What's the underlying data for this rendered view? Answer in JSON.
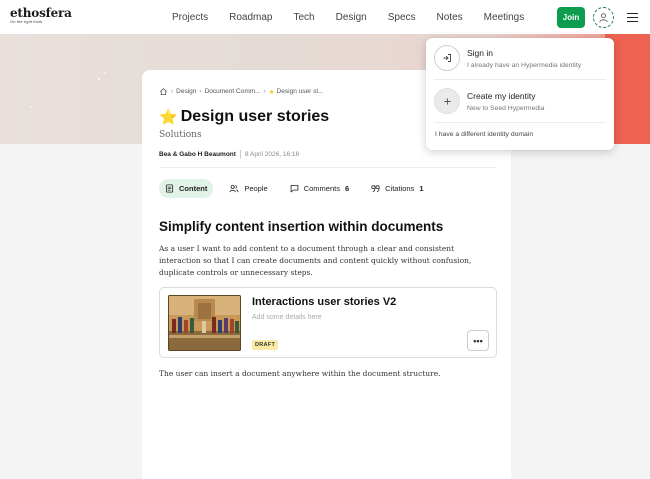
{
  "brand": {
    "name": "ethosfera",
    "tagline": "On the right think"
  },
  "nav": {
    "items": [
      {
        "label": "Projects"
      },
      {
        "label": "Roadmap"
      },
      {
        "label": "Tech"
      },
      {
        "label": "Design"
      },
      {
        "label": "Specs"
      },
      {
        "label": "Notes"
      },
      {
        "label": "Meetings"
      }
    ],
    "join_label": "Join"
  },
  "document": {
    "breadcrumb": [
      "Design",
      "Document Comm...",
      "Design user st..."
    ],
    "title": "Design user stories",
    "subtitle": "Solutions",
    "authors": "Bea & Gabo H Beaumont",
    "date": "8 April 2026, 16:16",
    "tabs": [
      {
        "label": "Content",
        "count": ""
      },
      {
        "label": "People",
        "count": ""
      },
      {
        "label": "Comments",
        "count": "6"
      },
      {
        "label": "Citations",
        "count": "1"
      }
    ],
    "section_heading": "Simplify content insertion within documents",
    "paragraph": "As a user I want to add content to a document through a clear and consistent interaction so that I can create documents and content quickly without confusion, duplicate controls or unnecessary steps.",
    "embed": {
      "title": "Interactions user stories V2",
      "placeholder": "Add some details here",
      "badge": "DRAFT",
      "more_label": "•••"
    },
    "paragraph2": "The user can insert a document anywhere within the document structure."
  },
  "identity_menu": {
    "sign_in": {
      "title": "Sign in",
      "subtitle": "I already have an Hypermedia identity"
    },
    "create": {
      "title": "Create my identity",
      "subtitle": "New to Seed Hypermedia"
    },
    "other_domain": "I have a different identity domain"
  },
  "colors": {
    "accent_green": "#0e9d4e",
    "active_tab_bg": "#e1f2e6",
    "draft_badge": "#fbeaa5",
    "banner_red": "#ee6251"
  }
}
